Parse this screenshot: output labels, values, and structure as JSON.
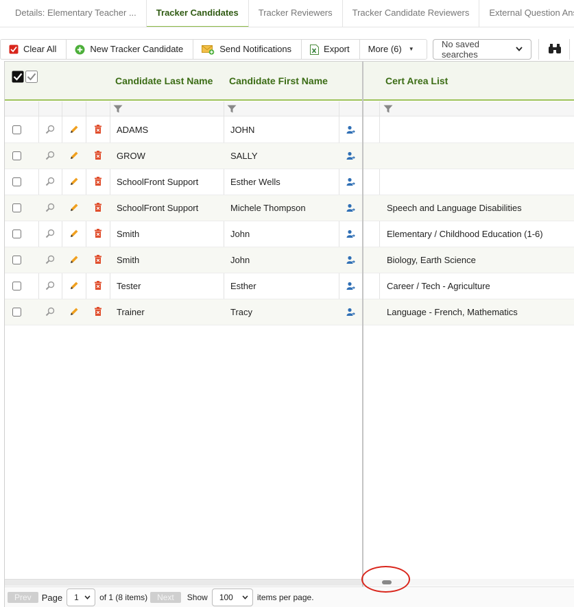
{
  "tabs": [
    {
      "label": "Details: Elementary Teacher ...",
      "active": false
    },
    {
      "label": "Tracker Candidates",
      "active": true
    },
    {
      "label": "Tracker Reviewers",
      "active": false
    },
    {
      "label": "Tracker Candidate Reviewers",
      "active": false
    },
    {
      "label": "External Question Answers",
      "active": false
    }
  ],
  "toolbar": {
    "clear_all": "Clear All",
    "new_candidate": "New Tracker Candidate",
    "send_notifications": "Send Notifications",
    "export": "Export",
    "more": "More (6)",
    "saved_searches": "No saved searches"
  },
  "grid": {
    "headers": {
      "last_name": "Candidate Last Name",
      "first_name": "Candidate First Name",
      "cert_area": "Cert Area List"
    },
    "rows": [
      {
        "last": "ADAMS",
        "first": "JOHN",
        "cert": ""
      },
      {
        "last": "GROW",
        "first": "SALLY",
        "cert": ""
      },
      {
        "last": "SchoolFront Support",
        "first": "Esther Wells",
        "cert": ""
      },
      {
        "last": "SchoolFront Support",
        "first": "Michele Thompson",
        "cert": "Speech and Language Disabilities"
      },
      {
        "last": "Smith",
        "first": "John",
        "cert": "Elementary / Childhood Education (1-6)"
      },
      {
        "last": "Smith",
        "first": "John",
        "cert": "Biology, Earth Science"
      },
      {
        "last": "Tester",
        "first": "Esther",
        "cert": "Career / Tech - Agriculture"
      },
      {
        "last": "Trainer",
        "first": "Tracy",
        "cert": "Language - French, Mathematics"
      }
    ]
  },
  "pager": {
    "prev": "Prev",
    "page_label": "Page",
    "page_value": "1",
    "of_label": "of 1 (8 items)",
    "next": "Next",
    "show_label": "Show",
    "page_size": "100",
    "per_page_label": "items per page."
  },
  "colors": {
    "accent_green": "#3b6c15",
    "header_underline": "#9dc25a",
    "delete_red": "#e04c2a",
    "highlight_circle": "#d9251b"
  }
}
